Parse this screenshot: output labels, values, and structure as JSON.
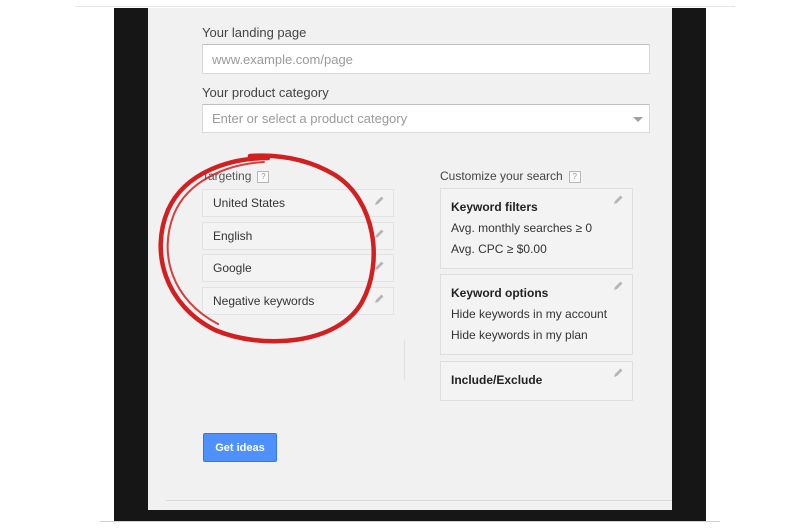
{
  "form": {
    "landing_page": {
      "label": "Your landing page",
      "placeholder": "www.example.com/page"
    },
    "product_category": {
      "label": "Your product category",
      "placeholder": "Enter or select a product category"
    }
  },
  "targeting": {
    "label": "Targeting",
    "help": "?",
    "items": [
      {
        "label": "United States"
      },
      {
        "label": "English"
      },
      {
        "label": "Google"
      },
      {
        "label": "Negative keywords"
      }
    ]
  },
  "customize": {
    "label": "Customize your search",
    "help": "?",
    "cards": [
      {
        "title": "Keyword filters",
        "lines": [
          "Avg. monthly searches ≥ 0",
          "Avg. CPC ≥ $0.00"
        ]
      },
      {
        "title": "Keyword options",
        "lines": [
          "Hide keywords in my account",
          "Hide keywords in my plan"
        ]
      },
      {
        "title": "Include/Exclude",
        "lines": []
      }
    ]
  },
  "actions": {
    "get_ideas_label": "Get ideas"
  },
  "annotation": {
    "color": "#d21f1f",
    "shape": "hand-drawn-circle"
  },
  "colors": {
    "accent": "#4d90fe",
    "frame": "#161616",
    "panel": "#f1f1f1"
  }
}
